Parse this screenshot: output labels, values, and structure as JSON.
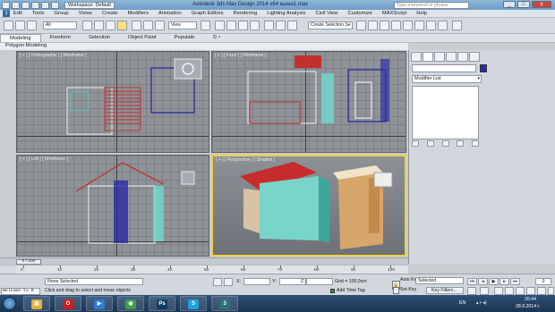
{
  "window": {
    "workspace_label": "Workspace: Default",
    "title": "Autodesk 3ds Max Design 2014 x64      кышa1.max",
    "search_placeholder": "Type a keyword or phrase",
    "min_glyph": "_",
    "max_glyph": "□",
    "close_glyph": "x"
  },
  "menu": {
    "logo_glyph": "3",
    "items": [
      "Edit",
      "Tools",
      "Group",
      "Views",
      "Create",
      "Modifiers",
      "Animation",
      "Graph Editors",
      "Rendering",
      "Lighting Analysis",
      "Civil View",
      "Customize",
      "MAXScript",
      "Help"
    ]
  },
  "toolbar": {
    "selection_filter": "All",
    "reference_coord": "View",
    "named_selection_placeholder": "Create Selection Se"
  },
  "ribbon": {
    "tabs": [
      "Modeling",
      "Freeform",
      "Selection",
      "Object Paint",
      "Populate"
    ],
    "active_tab": "Modeling",
    "more_glyph": "⊙ •",
    "panel_label": "Polygon Modeling"
  },
  "viewports": {
    "top_left": "[ + ] [ Orthographic ] [ Wireframe ]",
    "top_right": "[ + ] [ Front ] [ Wireframe ]",
    "bottom_left": "[ + ] [ Left ] [ Wireframe ]",
    "bottom_right": "[ + ] [ Perspective ] [ Shaded ]"
  },
  "command_panel": {
    "modifier_list": "Modifier List",
    "dropdown_glyph": "▾",
    "object_color": "#2a2aa6"
  },
  "timeline": {
    "slider_label": "0 / 100",
    "ticks": [
      "0",
      "10",
      "20",
      "30",
      "40",
      "50",
      "60",
      "70",
      "80",
      "90",
      "100"
    ]
  },
  "status": {
    "maxscript_text": "Welcome to M",
    "selection_text": "None Selected",
    "prompt_text": "Click and drag to select and move objects",
    "coord_labels": [
      "X:",
      "Y:",
      "Z:"
    ],
    "grid_text": "Grid = 100,0cm",
    "add_time_tag": "Add Time Tag",
    "lock_glyph": "🔒",
    "auto_key": "Auto Key",
    "set_key": "Set Key",
    "selected_dropdown": "Selected",
    "key_filters": "Key Filters...",
    "playback_glyphs": [
      "⏮",
      "◂",
      "▶",
      "▸",
      "⏭"
    ],
    "current_frame": "0"
  },
  "taskbar": {
    "apps": [
      {
        "name": "File Explorer",
        "glyph": "▤",
        "color": "#e2b23a"
      },
      {
        "name": "Opera",
        "glyph": "O",
        "color": "#cc1f1f"
      },
      {
        "name": "Media Player",
        "glyph": "▶",
        "color": "#2f7bd6"
      },
      {
        "name": "Chrome",
        "glyph": "◉",
        "color": "#3aa04a"
      },
      {
        "name": "Photoshop",
        "glyph": "Ps",
        "color": "#0f3d63"
      },
      {
        "name": "Skype",
        "glyph": "S",
        "color": "#1ea1e0"
      },
      {
        "name": "3ds Max",
        "glyph": "3",
        "color": "#2f6f7a"
      }
    ],
    "language": "EN",
    "time": "20:44",
    "date": "28.9.2014 г."
  }
}
